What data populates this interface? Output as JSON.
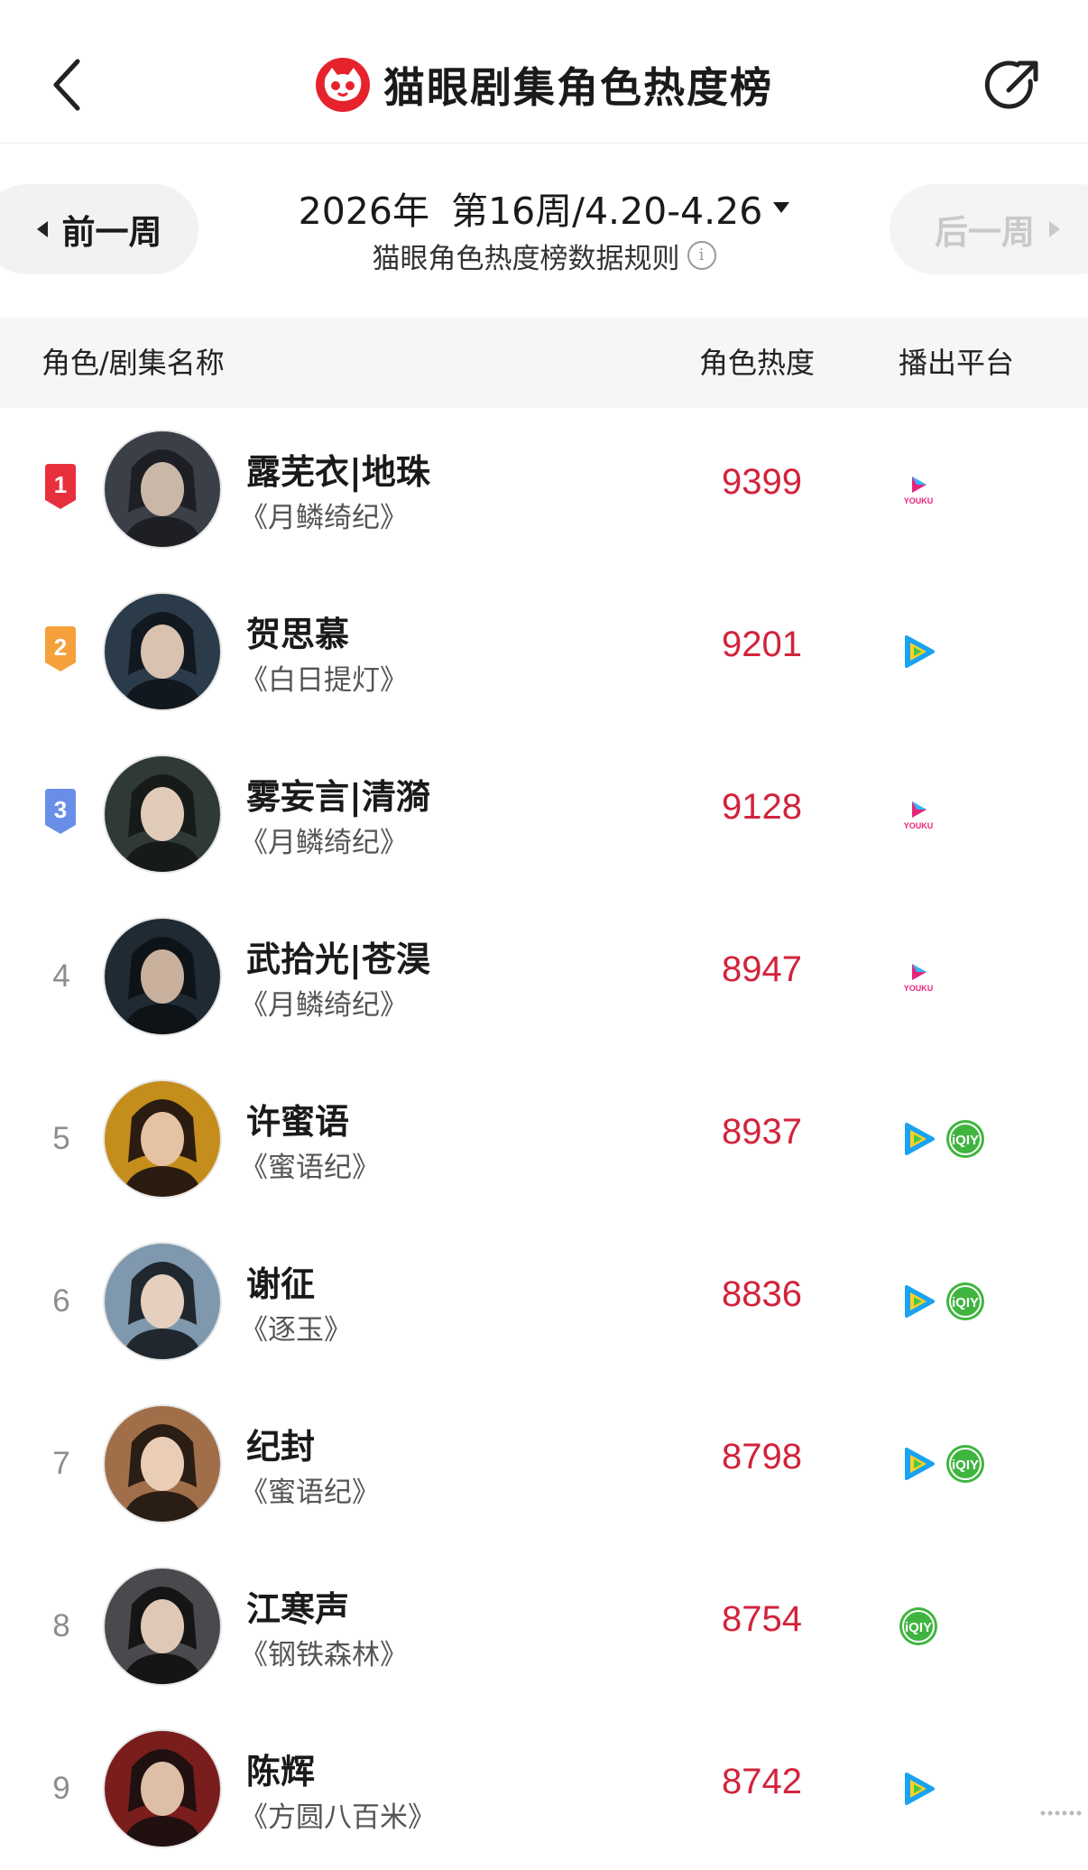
{
  "header": {
    "title": "猫眼剧集角色热度榜",
    "back_icon": "chevron-left-icon",
    "share_icon": "share-icon",
    "brand_color": "#e6222c"
  },
  "week_selector": {
    "prev_label": "前一周",
    "next_label": "后一周",
    "year": "2026年",
    "week": "第16周/4.20-4.26",
    "rules_label": "猫眼角色热度榜数据规则",
    "next_disabled": true
  },
  "columns": {
    "name": "角色/剧集名称",
    "heat": "角色热度",
    "platform": "播出平台"
  },
  "accent_color": "#d2233c",
  "rows": [
    {
      "rank": "1",
      "name": "露芜衣|地珠",
      "drama": "《月鳞绮纪》",
      "heat": "9399",
      "platforms": [
        "youku"
      ],
      "badge_color": "#e8303d"
    },
    {
      "rank": "2",
      "name": "贺思慕",
      "drama": "《白日提灯》",
      "heat": "9201",
      "platforms": [
        "tencent"
      ],
      "badge_color": "#f5a03a"
    },
    {
      "rank": "3",
      "name": "雾妄言|清漪",
      "drama": "《月鳞绮纪》",
      "heat": "9128",
      "platforms": [
        "youku"
      ],
      "badge_color": "#6a8ee8"
    },
    {
      "rank": "4",
      "name": "武拾光|苍淏",
      "drama": "《月鳞绮纪》",
      "heat": "8947",
      "platforms": [
        "youku"
      ]
    },
    {
      "rank": "5",
      "name": "许蜜语",
      "drama": "《蜜语纪》",
      "heat": "8937",
      "platforms": [
        "tencent",
        "iqiyi"
      ]
    },
    {
      "rank": "6",
      "name": "谢征",
      "drama": "《逐玉》",
      "heat": "8836",
      "platforms": [
        "tencent",
        "iqiyi"
      ]
    },
    {
      "rank": "7",
      "name": "纪封",
      "drama": "《蜜语纪》",
      "heat": "8798",
      "platforms": [
        "tencent",
        "iqiyi"
      ]
    },
    {
      "rank": "8",
      "name": "江寒声",
      "drama": "《钢铁森林》",
      "heat": "8754",
      "platforms": [
        "iqiyi"
      ]
    },
    {
      "rank": "9",
      "name": "陈辉",
      "drama": "《方圆八百米》",
      "heat": "8742",
      "platforms": [
        "tencent"
      ]
    }
  ],
  "platform_icons": {
    "youku": "youku-icon",
    "tencent": "tencent-video-icon",
    "iqiyi": "iqiyi-icon"
  }
}
